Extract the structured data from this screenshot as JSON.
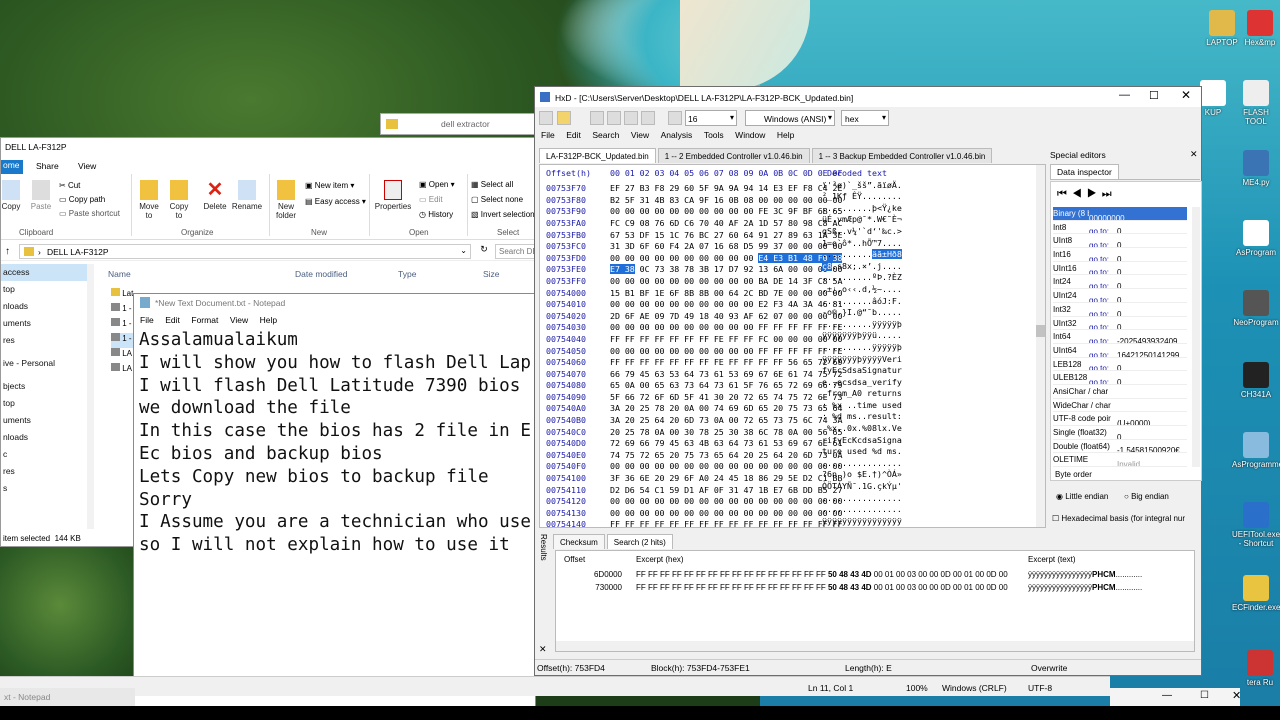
{
  "desktop": {
    "icons": [
      "LAPTOP",
      "Hex&mp",
      "KUP",
      "FLASH TOOL",
      "ME4.py",
      "AsProgram",
      "NeoProgram",
      "CH341A",
      "AsProgrammer",
      "UEFITool.exe - Shortcut",
      "ECFinder.exe",
      "tera Ru"
    ]
  },
  "explorer": {
    "title": "DELL LA-F312P",
    "tabs": [
      "ome",
      "Share",
      "View"
    ],
    "clipboard": {
      "group": "Clipboard",
      "copy": "Copy",
      "paste": "Paste",
      "cut": "Cut",
      "copy_path": "Copy path",
      "paste_shortcut": "Paste shortcut"
    },
    "organize": {
      "group": "Organize",
      "move_to": "Move to",
      "copy_to": "Copy to",
      "delete": "Delete",
      "rename": "Rename"
    },
    "new": {
      "group": "New",
      "new_folder": "New folder",
      "new_item": "New item",
      "easy_access": "Easy access"
    },
    "open": {
      "group": "Open",
      "properties": "Properties",
      "open": "Open",
      "edit": "Edit",
      "history": "History"
    },
    "select": {
      "group": "Select",
      "select_all": "Select all",
      "select_none": "Select none",
      "invert": "Invert selection"
    },
    "address": "DELL LA-F312P",
    "search_placeholder": "Search DE",
    "nav": [
      "access",
      "top",
      "nloads",
      "uments",
      "res",
      "ive - Personal",
      "bjects",
      "top",
      "uments",
      "nloads",
      "c",
      "res",
      "s"
    ],
    "columns": {
      "name": "Name",
      "date": "Date modified",
      "type": "Type",
      "size": "Size"
    },
    "files": [
      "Lat",
      "1 -",
      "1 -",
      "1 -",
      "LA",
      "LA"
    ],
    "status": "item selected  144 KB"
  },
  "notepad": {
    "title": "*New Text Document.txt - Notepad",
    "menu": [
      "File",
      "Edit",
      "Format",
      "View",
      "Help"
    ],
    "lines": [
      "Assalamualaikum",
      "I will show you how to flash Dell Lap",
      "I will flash Dell Latitude 7390 bios",
      "we download the file",
      "In this case the bios has 2 file in E",
      "Ec bios and backup bios",
      "Lets Copy new bios to backup file",
      "Sorry",
      "I Assume you are a technician who use",
      "so I will not explain how to use it"
    ],
    "status": {
      "pos": "Ln 11, Col 1",
      "zoom": "100%",
      "eol": "Windows (CRLF)",
      "enc": "UTF-8"
    },
    "taskbar_label": "xt - Notepad"
  },
  "hxd": {
    "title": "HxD - [C:\\Users\\Server\\Desktop\\DELL LA-F312P\\LA-F312P-BCK_Updated.bin]",
    "toolbar": {
      "columns": "16",
      "charset": "Windows (ANSI)",
      "base": "hex"
    },
    "menu": [
      "File",
      "Edit",
      "Search",
      "View",
      "Analysis",
      "Tools",
      "Window",
      "Help"
    ],
    "tabs": [
      "LA-F312P-BCK_Updated.bin",
      "1 -- 2 Embedded Controller v1.0.46.bin",
      "1 -- 3 Backup Embedded Controller v1.0.46.bin"
    ],
    "header": {
      "offset": "Offset(h)",
      "cols": "00 01 02 03 04 05 06 07 08 09 0A 0B 0C 0D 0E 0F",
      "decoded": "Decoded text"
    },
    "rows": [
      {
        "o": "00753F70",
        "b": "EF 27 B3 F8 29 60 5F 9A 9A 94 14 E3 EF F8 C4 2E",
        "t": "ï'³ø)`_šš”.ãïøÄ."
      },
      {
        "o": "00753F80",
        "b": "B2 5F 31 4B 83 CA 9F 16 0B 08 00 00 00 00 00 00",
        "t": "²_1Kƒ ÊŸ........"
      },
      {
        "o": "00753F90",
        "b": "00 00 00 00 00 00 00 00 00 00 FE 3C 9F BF 6B 65",
        "t": "..........þ<Ÿ¿ke"
      },
      {
        "o": "00753FA0",
        "b": "FC C9 08 76 6D C6 70 40 AF 2A 1D 57 80 98 C8 AC",
        "t": "üÉ.vmÆp@¯*.W€˜È¬"
      },
      {
        "o": "00753FB0",
        "b": "67 53 DF 15 1C 76 BC 27 60 64 91 27 89 63 1A 3E",
        "t": "gSß..v¼'`d‘'‰c.>"
      },
      {
        "o": "00753FC0",
        "b": "31 3D 6F 60 F4 2A 07 16 68 D5 99 37 00 00 00 00",
        "t": "1=o`ô*..hÕ™7...."
      },
      {
        "o": "00753FD0",
        "b": "00 00 00 00 00 00 00 00 00 00 E4 E3 B1 48 F0 38",
        "t": "..........äã±Hð8",
        "s": true
      },
      {
        "o": "00753FE0",
        "b": "E7 38 0C 73 38 78 3B 17 D7 92 13 6A 00 00 00 00",
        "t": "ç8.s8x;.×’.j....",
        "s2": true
      },
      {
        "o": "00753FF0",
        "b": "00 00 00 00 00 00 00 00 00 00 BA DE 14 3F C8 5A",
        "t": "..........ºÞ.?ÈZ"
      },
      {
        "o": "00754000",
        "b": "15 B1 BF 1E 6F 8B 8B 00 64 2C BD 7E 00 00 00 00",
        "t": ".±¿.o‹‹.d,½~...."
      },
      {
        "o": "00754010",
        "b": "00 00 00 00 00 00 00 00 00 00 E2 F3 4A 3A 46 81",
        "t": "..........âóJ:F."
      },
      {
        "o": "00754020",
        "b": "2D 6F AE 09 7D 49 18 40 93 AF 62 07 00 00 00 00",
        "t": "-o®.}I.@“¯b....."
      },
      {
        "o": "00754030",
        "b": "00 00 00 00 00 00 00 00 00 00 FF FF FF FF FF FE",
        "t": "..........ÿÿÿÿÿþ"
      },
      {
        "o": "00754040",
        "b": "FF FF FF FF FF FF FF FE FF FF FC 00 00 00 00 00",
        "t": "ÿÿÿÿÿÿÿþÿÿü....."
      },
      {
        "o": "00754050",
        "b": "00 00 00 00 00 00 00 00 00 00 FF FF FF FF FF FE",
        "t": "..........ÿÿÿÿÿþ"
      },
      {
        "o": "00754060",
        "b": "FF FF FF FF FF FF FF FE FF FF FF FF 56 65 72 69",
        "t": "ÿÿÿÿÿÿÿþÿÿÿÿVeri"
      },
      {
        "o": "00754070",
        "b": "66 79 45 63 53 64 73 61 53 69 67 6E 61 74 75 72",
        "t": "fyEcSdsaSignatur"
      },
      {
        "o": "00754080",
        "b": "65 0A 00 65 63 73 64 73 61 5F 76 65 72 69 66 79",
        "t": "e..ecsdsa_verify"
      },
      {
        "o": "00754090",
        "b": "5F 66 72 6F 6D 5F 41 30 20 72 65 74 75 72 6E 73",
        "t": "_from_A0 returns"
      },
      {
        "o": "007540A0",
        "b": "3A 20 25 78 20 0A 00 74 69 6D 65 20 75 73 65 64",
        "t": ": %x ..time used"
      },
      {
        "o": "007540B0",
        "b": "3A 20 25 64 20 6D 73 0A 00 72 65 73 75 6C 74 3A",
        "t": ": %d ms..result:"
      },
      {
        "o": "007540C0",
        "b": "20 25 78 0A 00 30 78 25 30 38 6C 78 0A 00 56 65",
        "t": " %x..0x.%08lx.Ve"
      },
      {
        "o": "007540D0",
        "b": "72 69 66 79 45 63 4B 63 64 73 61 53 69 67 6E 61",
        "t": "rifyEcKcdsaSigna"
      },
      {
        "o": "007540E0",
        "b": "74 75 72 65 20 75 73 65 64 20 25 64 20 6D 73 0A",
        "t": "ture used %d ms."
      },
      {
        "o": "007540F0",
        "b": "00 00 00 00 00 00 00 00 00 00 00 00 00 00 00 00",
        "t": "................"
      },
      {
        "o": "00754100",
        "b": "3F 36 6E 20 29 6F A0 24 45 18 86 29 5E D2 C1 BB",
        "t": "?6n )o $E.†)^ÒÁ»"
      },
      {
        "o": "00754110",
        "b": "D2 D6 54 C1 59 D1 AF 0F 31 47 1B E7 6B DD B5 27",
        "t": "ÒÖTÁYÑ¯.1G.çkÝµ'"
      },
      {
        "o": "00754120",
        "b": "00 00 00 00 00 00 00 00 00 00 00 00 00 00 00 00",
        "t": "................"
      },
      {
        "o": "00754130",
        "b": "00 00 00 00 00 00 00 00 00 00 00 00 00 00 00 00",
        "t": "................"
      },
      {
        "o": "00754140",
        "b": "FF FF FF FF FF FF FF FF FF FF FF FF FF FF FF FF",
        "t": "ÿÿÿÿÿÿÿÿÿÿÿÿÿÿÿÿ"
      }
    ],
    "special_editors": "Special editors",
    "data_inspector": {
      "tab": "Data inspector",
      "rows": [
        {
          "k": "Binary (8 bit)",
          "v": "00000000",
          "sel": true
        },
        {
          "k": "Int8",
          "v": "0"
        },
        {
          "k": "UInt8",
          "v": "0"
        },
        {
          "k": "Int16",
          "v": "0"
        },
        {
          "k": "UInt16",
          "v": "0"
        },
        {
          "k": "Int24",
          "v": "0"
        },
        {
          "k": "UInt24",
          "v": "0"
        },
        {
          "k": "Int32",
          "v": "0"
        },
        {
          "k": "UInt32",
          "v": "0"
        },
        {
          "k": "Int64",
          "v": "-2025493932409"
        },
        {
          "k": "UInt64",
          "v": "16421250141299"
        },
        {
          "k": "LEB128",
          "v": "0"
        },
        {
          "k": "ULEB128",
          "v": "0"
        },
        {
          "k": "AnsiChar / char",
          "v": ""
        },
        {
          "k": "WideChar / char",
          "v": ""
        },
        {
          "k": "UTF-8 code poir",
          "v": "(U+0000)"
        },
        {
          "k": "Single (float32)",
          "v": "0"
        },
        {
          "k": "Double (float64)",
          "v": "-1,54581500920€"
        },
        {
          "k": "OLETIME",
          "v": "Invalid"
        },
        {
          "k": "FILETIME",
          "v": "Invalid"
        }
      ],
      "goto": "go to:",
      "byte_order": "Byte order",
      "little": "Little endian",
      "big": "Big endian",
      "hex_basis": "Hexadecimal basis (for integral nur"
    },
    "results": {
      "label": "Results",
      "tabs": [
        "Checksum",
        "Search (2 hits)"
      ],
      "cols": {
        "offset": "Offset",
        "hex": "Excerpt (hex)",
        "text": "Excerpt (text)"
      },
      "rows": [
        {
          "o": "6D0000",
          "h": "FF FF FF FF FF FF FF FF FF FF FF FF FF FF FF FF",
          "hb": "50 48 43 4D",
          "h2": "00 01 00 03 00 00 0D 00 01 00 0D 00",
          "tt": "ÿÿÿÿÿÿÿÿÿÿÿÿÿÿÿÿ",
          "tb": "PHCM",
          "t2": "............"
        },
        {
          "o": "730000",
          "h": "FF FF FF FF FF FF FF FF FF FF FF FF FF FF FF FF",
          "hb": "50 48 43 4D",
          "h2": "00 01 00 03 00 00 0D 00 01 00 0D 00",
          "tt": "ÿÿÿÿÿÿÿÿÿÿÿÿÿÿÿÿ",
          "tb": "PHCM",
          "t2": "............"
        }
      ]
    },
    "status": {
      "offset": "Offset(h): 753FD4",
      "block": "Block(h): 753FD4-753FE1",
      "length": "Length(h): E",
      "mode": "Overwrite"
    }
  }
}
